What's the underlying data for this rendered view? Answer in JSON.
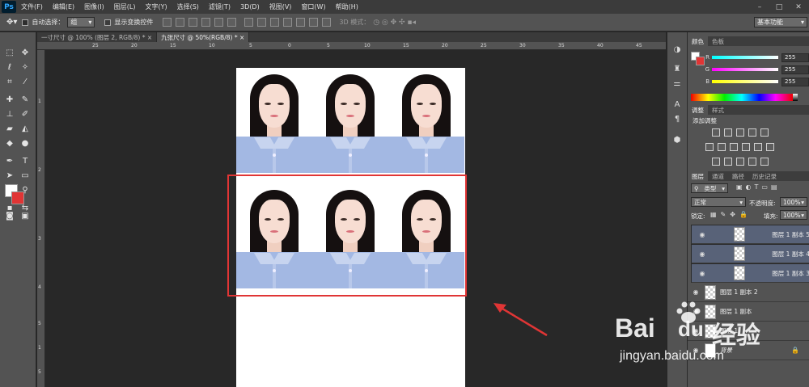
{
  "app": {
    "logo": "Ps"
  },
  "menu": [
    "文件(F)",
    "编辑(E)",
    "图像(I)",
    "图层(L)",
    "文字(Y)",
    "选择(S)",
    "滤镜(T)",
    "3D(D)",
    "视图(V)",
    "窗口(W)",
    "帮助(H)"
  ],
  "window_controls": [
    "–",
    "□",
    "✕"
  ],
  "options": {
    "auto_select_label": "自动选择：",
    "auto_select_value": "组",
    "show_transform_label": "显示变换控件",
    "mode_3d_label": "3D 模式：",
    "workspace": "基本功能"
  },
  "tabs": [
    {
      "label": "一寸尺寸 @ 100% (图层 2, RGB/8) *",
      "close": "×"
    },
    {
      "label": "九张尺寸 @ 50%(RGB/8) *",
      "close": "×"
    }
  ],
  "ruler_top": [
    "25",
    "20",
    "15",
    "10",
    "5",
    "0",
    "5",
    "10",
    "15",
    "20",
    "25",
    "30",
    "35",
    "40",
    "45"
  ],
  "ruler_left": [
    "1",
    "2",
    "3",
    "4",
    "5",
    "1",
    "5"
  ],
  "color_panel": {
    "tabs": [
      "颜色",
      "色板"
    ],
    "channels": [
      {
        "label": "R",
        "value": "255",
        "gradient": "#00ffff"
      },
      {
        "label": "G",
        "value": "255",
        "gradient": "#ff00ff"
      },
      {
        "label": "B",
        "value": "255",
        "gradient": "#ffff00"
      }
    ],
    "foreground": "#ffffff",
    "background": "#e03535"
  },
  "adjust_panel": {
    "tabs": [
      "调整",
      "样式"
    ],
    "title": "添加调整"
  },
  "layers_panel": {
    "tabs": [
      "图层",
      "通道",
      "路径",
      "历史记录"
    ],
    "filter_label": "类型",
    "blend_mode": "正常",
    "opacity_label": "不透明度:",
    "opacity_value": "100%",
    "lock_label": "锁定:",
    "fill_label": "填充:",
    "fill_value": "100%",
    "layers": [
      {
        "name": "图层 1 副本 5",
        "selected": true
      },
      {
        "name": "图层 1 副本 4",
        "selected": true
      },
      {
        "name": "图层 1 副本 3",
        "selected": true
      },
      {
        "name": "图层 1 副本 2",
        "selected": false
      },
      {
        "name": "图层 1 副本",
        "selected": false
      },
      {
        "name": "图层 1",
        "selected": false
      },
      {
        "name": "背景",
        "selected": false
      }
    ]
  },
  "watermark": {
    "brand": "Bai",
    "brand2": "du",
    "cn": "经验",
    "url": "jingyan.baidu.com"
  },
  "colors": {
    "accent": "#e03535",
    "selected_layer": "#586278",
    "shirt": "#a3b8e3"
  }
}
